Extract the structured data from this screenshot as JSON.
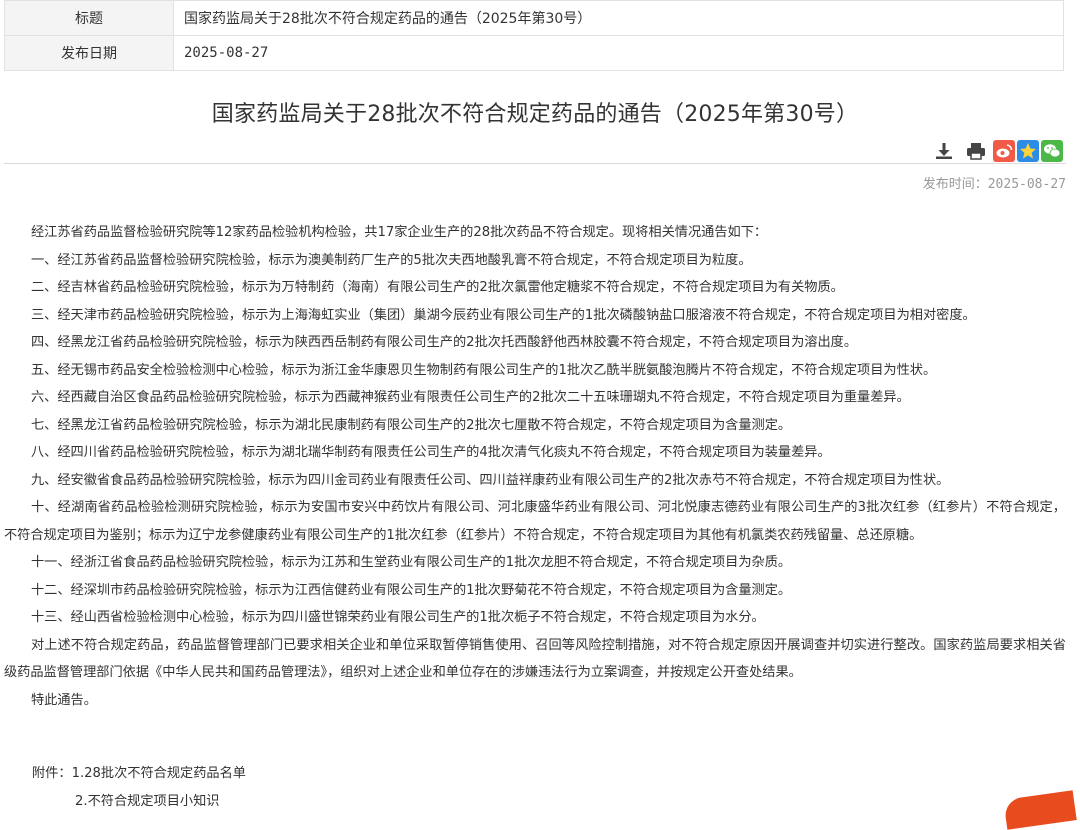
{
  "meta": {
    "title_label": "标题",
    "title_value": "国家药监局关于28批次不符合规定药品的通告（2025年第30号）",
    "date_label": "发布日期",
    "date_value": "2025-08-27"
  },
  "article": {
    "title": "国家药监局关于28批次不符合规定药品的通告（2025年第30号）",
    "pub_time_label": "发布时间：",
    "pub_time_value": "2025-08-27",
    "paragraphs": [
      "经江苏省药品监督检验研究院等12家药品检验机构检验，共17家企业生产的28批次药品不符合规定。现将相关情况通告如下：",
      "一、经江苏省药品监督检验研究院检验，标示为澳美制药厂生产的5批次夫西地酸乳膏不符合规定，不符合规定项目为粒度。",
      "二、经吉林省药品检验研究院检验，标示为万特制药（海南）有限公司生产的2批次氯雷他定糖浆不符合规定，不符合规定项目为有关物质。",
      "三、经天津市药品检验研究院检验，标示为上海海虹实业（集团）巢湖今辰药业有限公司生产的1批次磷酸钠盐口服溶液不符合规定，不符合规定项目为相对密度。",
      "四、经黑龙江省药品检验研究院检验，标示为陕西西岳制药有限公司生产的2批次托西酸舒他西林胶囊不符合规定，不符合规定项目为溶出度。",
      "五、经无锡市药品安全检验检测中心检验，标示为浙江金华康恩贝生物制药有限公司生产的1批次乙酰半胱氨酸泡腾片不符合规定，不符合规定项目为性状。",
      "六、经西藏自治区食品药品检验研究院检验，标示为西藏神猴药业有限责任公司生产的2批次二十五味珊瑚丸不符合规定，不符合规定项目为重量差异。",
      "七、经黑龙江省药品检验研究院检验，标示为湖北民康制药有限公司生产的2批次七厘散不符合规定，不符合规定项目为含量测定。",
      "八、经四川省药品检验研究院检验，标示为湖北瑞华制药有限责任公司生产的4批次清气化痰丸不符合规定，不符合规定项目为装量差异。",
      "九、经安徽省食品药品检验研究院检验，标示为四川金司药业有限责任公司、四川益祥康药业有限公司生产的2批次赤芍不符合规定，不符合规定项目为性状。",
      "十、经湖南省药品检验检测研究院检验，标示为安国市安兴中药饮片有限公司、河北康盛华药业有限公司、河北悦康志德药业有限公司生产的3批次红参（红参片）不符合规定，不符合规定项目为鉴别；标示为辽宁龙参健康药业有限公司生产的1批次红参（红参片）不符合规定，不符合规定项目为其他有机氯类农药残留量、总还原糖。",
      "十一、经浙江省食品药品检验研究院检验，标示为江苏和生堂药业有限公司生产的1批次龙胆不符合规定，不符合规定项目为杂质。",
      "十二、经深圳市药品检验研究院检验，标示为江西信健药业有限公司生产的1批次野菊花不符合规定，不符合规定项目为含量测定。",
      "十三、经山西省检验检测中心检验，标示为四川盛世锦荣药业有限公司生产的1批次栀子不符合规定，不符合规定项目为水分。",
      "对上述不符合规定药品，药品监督管理部门已要求相关企业和单位采取暂停销售使用、召回等风险控制措施，对不符合规定原因开展调查并切实进行整改。国家药监局要求相关省级药品监督管理部门依据《中华人民共和国药品管理法》，组织对上述企业和单位存在的涉嫌违法行为立案调查，并按规定公开查处结果。",
      "特此通告。"
    ],
    "attachments_label": "附件：",
    "attachments": [
      "1.28批次不符合规定药品名单",
      "2.不符合规定项目小知识"
    ]
  },
  "icons": {
    "download": "download-icon",
    "print": "print-icon",
    "weibo": "weibo-share-icon",
    "qzone": "qzone-share-icon",
    "wechat": "wechat-share-icon"
  },
  "colors": {
    "weibo": "#e6162d",
    "qzone": "#2d8de6",
    "wechat": "#4cb848",
    "pubtime": "#999999"
  }
}
